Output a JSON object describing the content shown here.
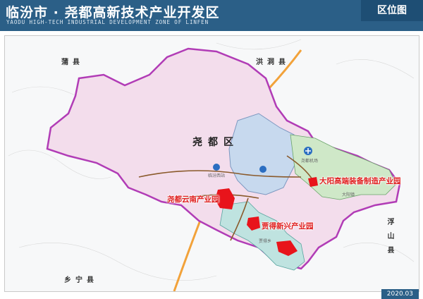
{
  "header": {
    "title": "临汾市 · 尧都高新技术产业开发区",
    "subtitle": "YAODU HIGH-TECH INDUSTRIAL DEVELOPMENT ZONE OF LINFEN",
    "badge": "区位图"
  },
  "map": {
    "counties": {
      "pu": "蒲县",
      "hongdong": "洪洞县",
      "fushan": "浮山县",
      "xiangning": "乡宁县"
    },
    "district": "尧都区",
    "parks": {
      "yunnan": "尧都云南产业园",
      "jiade": "贾得新兴产业园",
      "dayang": "大阳高端装备制造产业园"
    },
    "towns": {
      "dayang": "大阳镇",
      "airport": "尧都机场",
      "linfen_west": "临汾西站",
      "jiade": "贾得乡"
    },
    "colors": {
      "district_fill": "#f3ddec",
      "boundary": "#b13cb6",
      "park": "#e8141b",
      "highway": "#f2a23a",
      "road": "#8a5a2b"
    }
  },
  "footer": {
    "date": "2020.03"
  }
}
